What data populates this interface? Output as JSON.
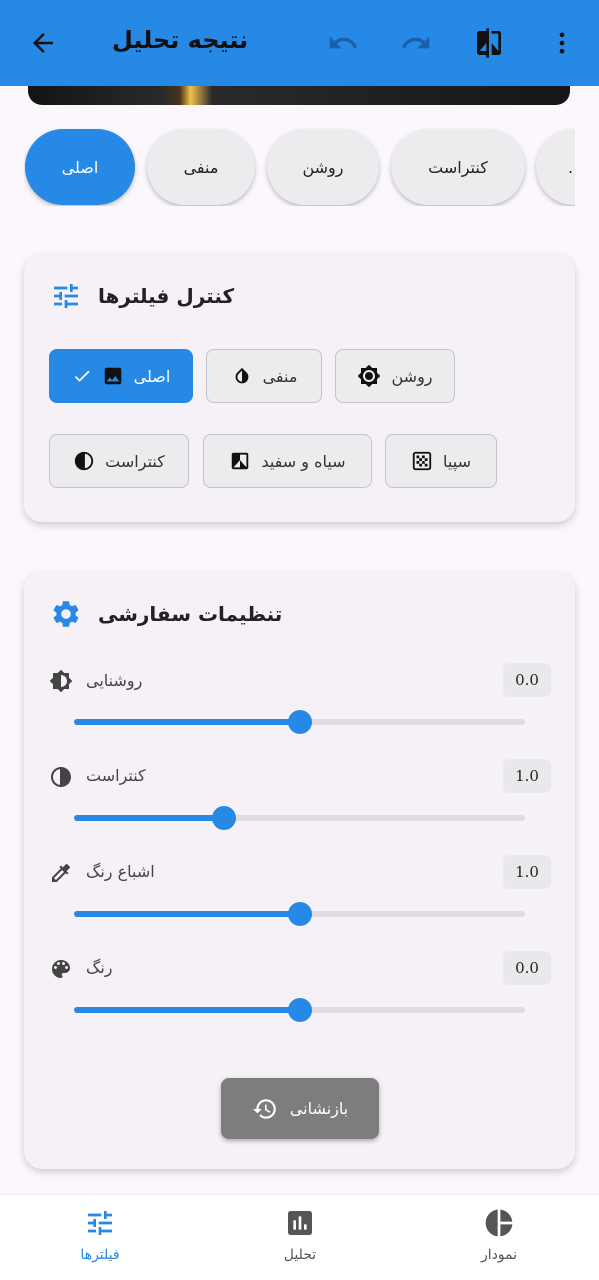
{
  "app_bar": {
    "title": "نتیجه تحلیل",
    "icons": [
      "back-arrow-icon",
      "undo-icon",
      "redo-icon",
      "compare-icon",
      "more-vert-icon"
    ]
  },
  "filter_chips": [
    {
      "label": "اصلی",
      "active": true
    },
    {
      "label": "منفی",
      "active": false
    },
    {
      "label": "روشن",
      "active": false
    },
    {
      "label": "کنتراست",
      "active": false
    },
    {
      "label": ".",
      "active": false
    }
  ],
  "filter_control": {
    "title": "کنترل فیلترها",
    "buttons": [
      {
        "label": "اصلی",
        "icon": "image-icon",
        "active": true
      },
      {
        "label": "منفی",
        "icon": "invert-icon",
        "active": false
      },
      {
        "label": "روشن",
        "icon": "brightness-icon",
        "active": false
      },
      {
        "label": "کنتراست",
        "icon": "contrast-icon",
        "active": false
      },
      {
        "label": "سیاه و سفید",
        "icon": "bw-icon",
        "active": false
      },
      {
        "label": "سپیا",
        "icon": "sepia-icon",
        "active": false
      }
    ]
  },
  "custom_settings": {
    "title": "تنظیمات سفارشی",
    "sliders": [
      {
        "label": "روشنایی",
        "value": "0.0",
        "fraction": 0.5,
        "icon": "brightness-icon"
      },
      {
        "label": "کنتراست",
        "value": "1.0",
        "fraction": 0.333,
        "icon": "contrast-icon"
      },
      {
        "label": "اشباع رنگ",
        "value": "1.0",
        "fraction": 0.5,
        "icon": "eyedropper-icon"
      },
      {
        "label": "رنگ",
        "value": "0.0",
        "fraction": 0.5,
        "icon": "palette-icon"
      }
    ],
    "reset_label": "بازنشانی"
  },
  "bottom_nav": [
    {
      "label": "فیلترها",
      "icon": "tune-icon",
      "active": true
    },
    {
      "label": "تحلیل",
      "icon": "bar-chart-icon",
      "active": false
    },
    {
      "label": "نمودار",
      "icon": "pie-chart-icon",
      "active": false
    }
  ],
  "colors": {
    "primary": "#2589e5",
    "reset": "#7d7d7d"
  }
}
